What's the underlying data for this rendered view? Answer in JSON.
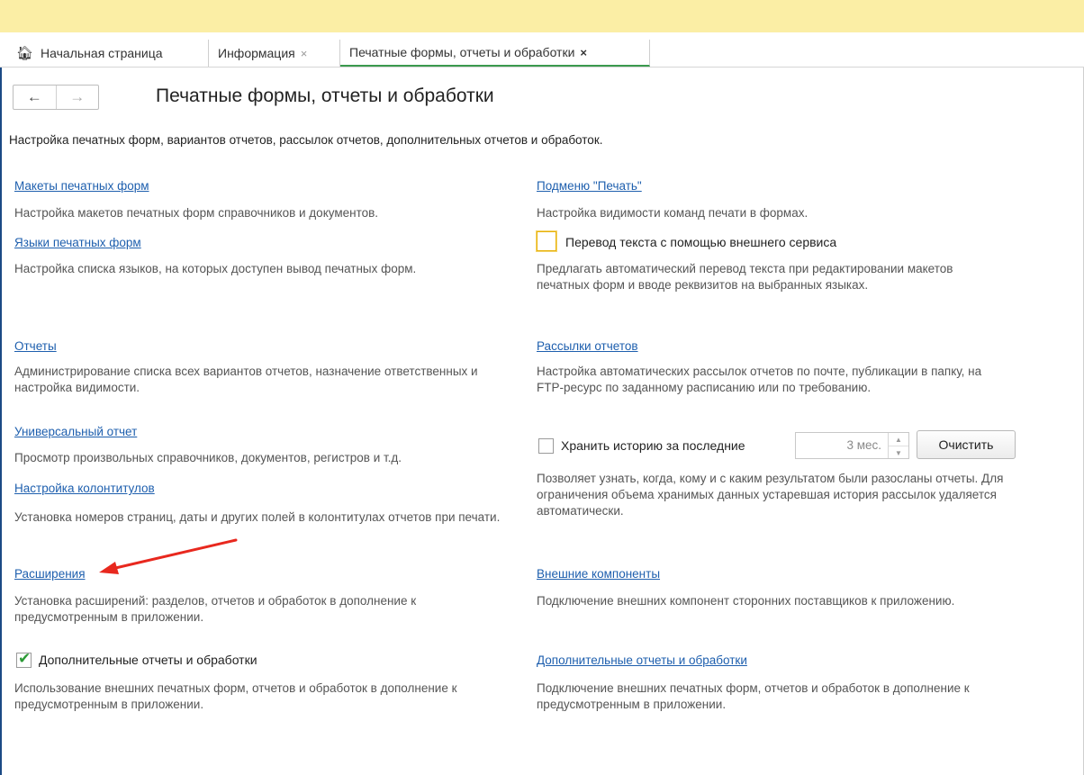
{
  "tabs": [
    {
      "label": "Начальная страница",
      "close": ""
    },
    {
      "label": "Информация",
      "close": "×"
    },
    {
      "label": "Печатные формы, отчеты и обработки",
      "close": "×"
    }
  ],
  "nav": {
    "back": "←",
    "forward": "→"
  },
  "page": {
    "title": "Печатные формы, отчеты и обработки",
    "subtitle": "Настройка печатных форм, вариантов отчетов, рассылок отчетов, дополнительных отчетов и обработок."
  },
  "left": {
    "makety_link": "Макеты печатных форм",
    "makety_desc": "Настройка макетов печатных форм справочников и документов.",
    "yazyki_link": "Языки печатных форм",
    "yazyki_desc": "Настройка списка языков, на которых доступен вывод печатных форм.",
    "otchety_link": "Отчеты",
    "otchety_desc": "Администрирование списка всех вариантов отчетов, назначение ответственных и настройка видимости.",
    "universal_link": "Универсальный отчет",
    "universal_desc": "Просмотр произвольных справочников, документов, регистров и т.д.",
    "kolontituly_link": "Настройка колонтитулов",
    "kolontituly_desc": "Установка номеров страниц, даты и других полей в колонтитулах отчетов при печати.",
    "rasshireniya_link": "Расширения",
    "rasshireniya_desc": "Установка расширений: разделов, отчетов и обработок в дополнение к предусмотренным в приложении.",
    "dop_checkbox": "Дополнительные отчеты и обработки",
    "dop_desc": "Использование внешних печатных форм, отчетов и обработок в дополнение к предусмотренным в приложении."
  },
  "right": {
    "podmenu_link": "Подменю \"Печать\"",
    "podmenu_desc": "Настройка видимости команд печати в формах.",
    "perevod_checkbox": "Перевод текста с помощью внешнего сервиса",
    "perevod_desc": "Предлагать автоматический перевод текста при редактировании макетов печатных форм и вводе реквизитов на выбранных языках.",
    "rassylki_link": "Рассылки отчетов",
    "rassylki_desc": "Настройка автоматических рассылок отчетов по почте, публикации в папку, на FTP-ресурс по заданному расписанию или по требованию.",
    "history_checkbox": "Хранить историю за последние",
    "history_value": "3 мес.",
    "clear_button": "Очистить",
    "history_desc": "Позволяет узнать, когда, кому и с каким результатом были разосланы отчеты. Для ограничения объема хранимых данных устаревшая история рассылок удаляется автоматически.",
    "vneshnie_link": "Внешние компоненты",
    "vneshnie_desc": "Подключение внешних компонент сторонних поставщиков к приложению.",
    "dop_link": "Дополнительные отчеты и обработки",
    "dop_desc": "Подключение внешних печатных форм, отчетов и обработок в дополнение к предусмотренным в приложении."
  },
  "colors": {
    "accent_green": "#3b9a4e",
    "link_blue": "#1e5fae",
    "arrow_red": "#e8281e",
    "topbar": "#fbeea5"
  }
}
